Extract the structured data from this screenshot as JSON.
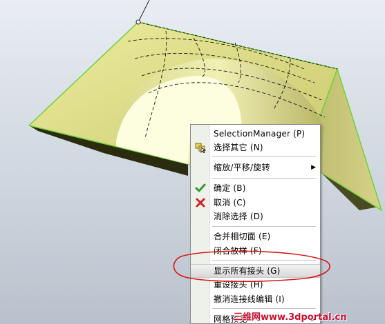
{
  "menu": {
    "items": [
      {
        "label": "SelectionManager (P)",
        "icon": "none"
      },
      {
        "label": "选择其它 (N)",
        "icon": "select-other-icon"
      },
      {
        "label": "缩放/平移/旋转",
        "icon": "none",
        "submenu": "▶"
      },
      {
        "label": "确定 (B)",
        "icon": "checkmark-icon",
        "icon_color": "#2e9a2e"
      },
      {
        "label": "取消 (C)",
        "icon": "cross-icon",
        "icon_color": "#d02020"
      },
      {
        "label": "消除选择 (D)",
        "icon": "none"
      },
      {
        "label": "合并相切面 (E)",
        "icon": "none"
      },
      {
        "label": "闭合放样 (F)",
        "icon": "none"
      },
      {
        "label": "显示所有接头 (G)",
        "icon": "none",
        "state": "highlighted"
      },
      {
        "label": "重设接头 (H)",
        "icon": "none"
      },
      {
        "label": "撤消连接线编辑 (I)",
        "icon": "none"
      },
      {
        "label": "网格预览",
        "icon": "none",
        "submenu": "▶"
      }
    ]
  },
  "annotation": {
    "shape": "ellipse",
    "color": "#d81818"
  },
  "watermark": {
    "text": "三维网www.3dportal.cn",
    "color": "#c8102e"
  },
  "colors": {
    "surface_fill": "#e6e48c",
    "surface_edge": "#6fd23a",
    "underside": "#2b2b10",
    "hole": "#fdfde0"
  }
}
